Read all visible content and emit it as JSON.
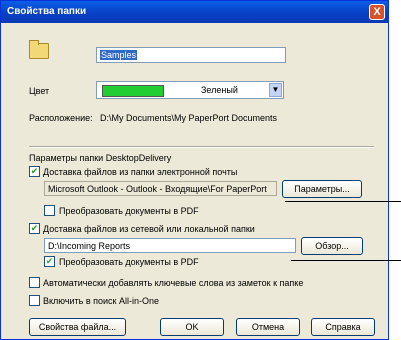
{
  "window": {
    "title": "Свойства папки",
    "close_label": "X"
  },
  "name_field": {
    "value": "Samples"
  },
  "color": {
    "label": "Цвет",
    "selected": "Зеленый",
    "swatch": "#22cc33",
    "arrow": "▼"
  },
  "location": {
    "label": "Расположение:",
    "value": "D:\\My Documents\\My PaperPort Documents"
  },
  "group_title": "Параметры папки DesktopDelivery",
  "email_delivery": {
    "checkbox_label": "Доставка файлов из папки электронной почты",
    "checked": true,
    "path": "Microsoft Outlook - Outlook - Входящие\\For PaperPort",
    "button": "Параметры...",
    "convert_label": "Преобразовать документы в PDF",
    "convert_checked": false
  },
  "local_delivery": {
    "checkbox_label": "Доставка файлов из сетевой или локальной папки",
    "checked": true,
    "path": "D:\\Incoming Reports",
    "button": "Обзор...",
    "convert_label": "Преобразовать документы в PDF",
    "convert_checked": true
  },
  "auto_keywords": {
    "label": "Автоматически добавлять ключевые слова из заметок к папке",
    "checked": false
  },
  "search_include": {
    "label": "Включить в поиск All-in-One",
    "checked": false
  },
  "buttons": {
    "file_props": "Свойства файла...",
    "ok": "OK",
    "cancel": "Отмена",
    "help": "Справка"
  },
  "check_mark": "✔"
}
